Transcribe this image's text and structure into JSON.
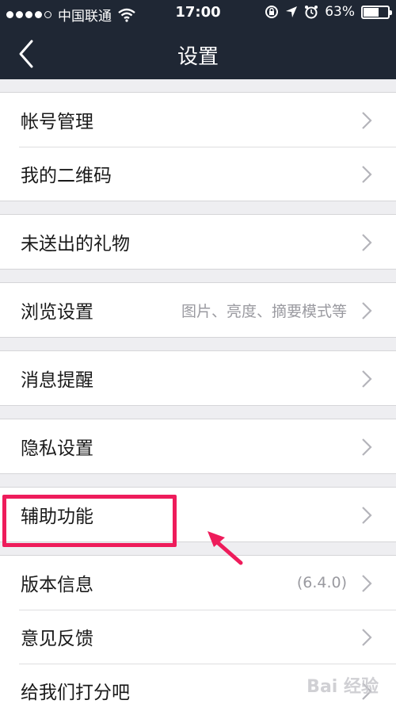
{
  "status_bar": {
    "carrier": "中国联通",
    "time": "17:00",
    "battery": "63%",
    "battery_level": 0.63,
    "signal_icon": "signal-dots-icon",
    "wifi_icon": "wifi-icon"
  },
  "nav": {
    "title": "设置",
    "back_icon": "chevron-left-icon"
  },
  "groups": [
    {
      "rows": [
        {
          "label": "帐号管理"
        },
        {
          "label": "我的二维码"
        }
      ]
    },
    {
      "rows": [
        {
          "label": "未送出的礼物"
        }
      ]
    },
    {
      "rows": [
        {
          "label": "浏览设置",
          "value": "图片、亮度、摘要模式等"
        }
      ]
    },
    {
      "rows": [
        {
          "label": "消息提醒"
        }
      ]
    },
    {
      "rows": [
        {
          "label": "隐私设置"
        }
      ]
    },
    {
      "rows": [
        {
          "label": "辅助功能"
        }
      ]
    },
    {
      "rows": [
        {
          "label": "版本信息",
          "value": "(6.4.0)"
        },
        {
          "label": "意见反馈"
        },
        {
          "label": "给我们打分吧"
        }
      ]
    }
  ],
  "annotation": {
    "highlight_color": "#ee1c5b"
  },
  "watermark": "Bai 经验"
}
